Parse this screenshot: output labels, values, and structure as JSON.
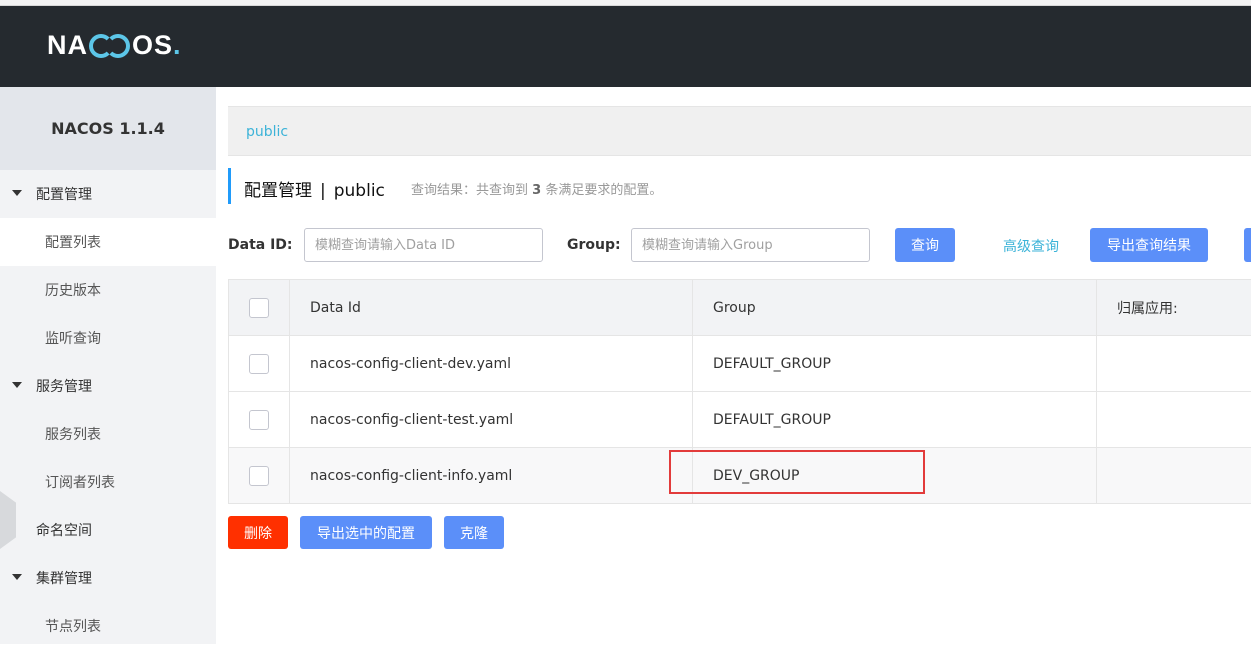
{
  "header": {
    "logo_text_left": "NA",
    "logo_text_right": "OS",
    "logo_dot": "."
  },
  "sidebar": {
    "title": "NACOS 1.1.4",
    "items": [
      {
        "label": "配置管理",
        "type": "group"
      },
      {
        "label": "配置列表",
        "type": "sub",
        "active": true
      },
      {
        "label": "历史版本",
        "type": "sub"
      },
      {
        "label": "监听查询",
        "type": "sub"
      },
      {
        "label": "服务管理",
        "type": "group"
      },
      {
        "label": "服务列表",
        "type": "sub"
      },
      {
        "label": "订阅者列表",
        "type": "sub"
      },
      {
        "label": "命名空间",
        "type": "plain"
      },
      {
        "label": "集群管理",
        "type": "group"
      },
      {
        "label": "节点列表",
        "type": "sub"
      }
    ]
  },
  "namespace_bar": {
    "label": "public"
  },
  "page_title": {
    "title": "配置管理",
    "separator": "|",
    "namespace": "public",
    "hint_prefix": "查询结果：共查询到",
    "hint_count": "3",
    "hint_suffix": "条满足要求的配置。"
  },
  "search": {
    "data_id_label": "Data ID:",
    "data_id_placeholder": "模糊查询请输入Data ID",
    "data_id_value": "",
    "group_label": "Group:",
    "group_placeholder": "模糊查询请输入Group",
    "group_value": "",
    "query_button": "查询",
    "advanced_link": "高级查询",
    "export_button": "导出查询结果"
  },
  "table": {
    "columns": [
      "Data Id",
      "Group",
      "归属应用:"
    ],
    "rows": [
      {
        "data_id": "nacos-config-client-dev.yaml",
        "group": "DEFAULT_GROUP",
        "app": ""
      },
      {
        "data_id": "nacos-config-client-test.yaml",
        "group": "DEFAULT_GROUP",
        "app": ""
      },
      {
        "data_id": "nacos-config-client-info.yaml",
        "group": "DEV_GROUP",
        "app": ""
      }
    ]
  },
  "actions": {
    "delete": "删除",
    "export_selected": "导出选中的配置",
    "clone": "克隆"
  },
  "colors": {
    "header_bg": "#252a2f",
    "accent": "#5cc6e8",
    "primary_button": "#5b8ff9",
    "delete_button": "#ff3000",
    "highlight_box": "#e23b3b",
    "link": "#3cb3d8"
  }
}
